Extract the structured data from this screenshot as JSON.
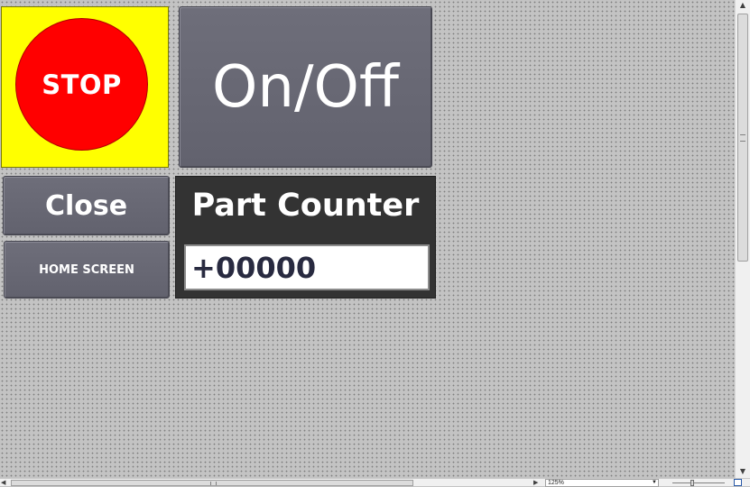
{
  "screen": {
    "stop_button": {
      "label": "STOP",
      "colors": {
        "panel": "#ffff00",
        "circle": "#ff0000"
      }
    },
    "onoff_button": {
      "label": "On/Off"
    },
    "close_button": {
      "label": "Close"
    },
    "home_button": {
      "label": "HOME SCREEN"
    },
    "part_counter": {
      "title": "Part Counter",
      "value": "+00000"
    }
  },
  "status_bar": {
    "zoom_level": "125%",
    "icons": {
      "scroll_up": "arrow-up-icon",
      "scroll_down": "arrow-down-icon",
      "scroll_left": "arrow-left-icon",
      "scroll_right": "arrow-right-icon",
      "zoom_dropdown": "chevron-down-icon",
      "fit": "fit-to-window-icon"
    }
  },
  "colors": {
    "canvas": "#c3c3c3",
    "button_face": "#666672",
    "counter_panel": "#333333",
    "counter_text": "#282a40"
  }
}
